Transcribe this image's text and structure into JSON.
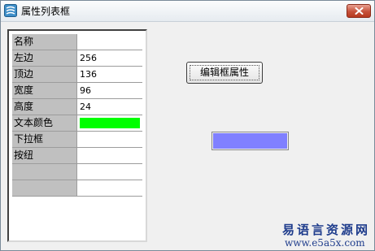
{
  "window": {
    "title": "属性列表框"
  },
  "properties": [
    {
      "name": "名称",
      "value": ""
    },
    {
      "name": "左边",
      "value": "256"
    },
    {
      "name": "顶边",
      "value": "136"
    },
    {
      "name": "宽度",
      "value": "96"
    },
    {
      "name": "高度",
      "value": "24"
    },
    {
      "name": "文本颜色",
      "value": "",
      "color": "#00ff00"
    },
    {
      "name": "下拉框",
      "value": ""
    },
    {
      "name": "按纽",
      "value": ""
    },
    {
      "name": "",
      "value": ""
    },
    {
      "name": "",
      "value": ""
    }
  ],
  "actions": {
    "edit_props_label": "编辑框属性"
  },
  "preview": {
    "color": "#8080ff"
  },
  "watermark": {
    "line1": "易语言资源网",
    "line2": "www.e5a5x.com"
  },
  "colors": {
    "watermark_text": "#1e3c8c",
    "close_button": "#c6513a",
    "name_cell_bg": "#c0c0c0"
  }
}
